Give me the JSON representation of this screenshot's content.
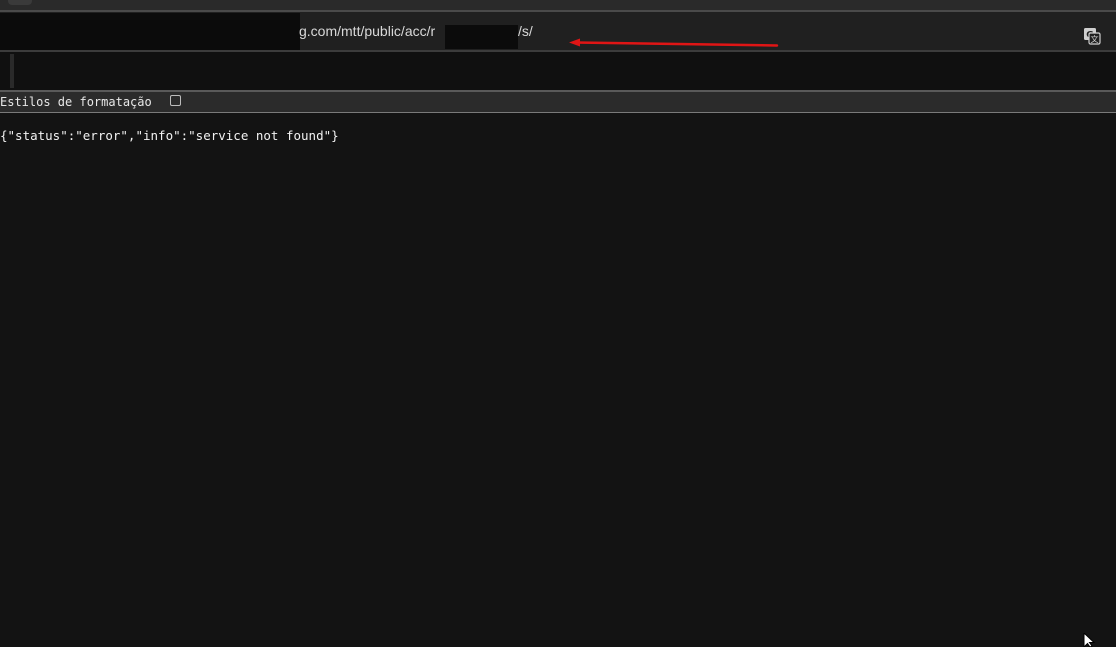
{
  "address_bar": {
    "url_visible_part_1": "g.com/mtt/public/acc/r",
    "url_visible_part_2": "/s/",
    "translate_icon": "translate-icon",
    "annotation_arrow_color": "#e01515"
  },
  "format_bar": {
    "label": "Estilos de formatação",
    "checkbox_checked": false
  },
  "response": {
    "body": "{\"status\":\"error\",\"info\":\"service not found\"}"
  },
  "colors": {
    "page_background": "#131313",
    "text": "#f2f2f2"
  }
}
